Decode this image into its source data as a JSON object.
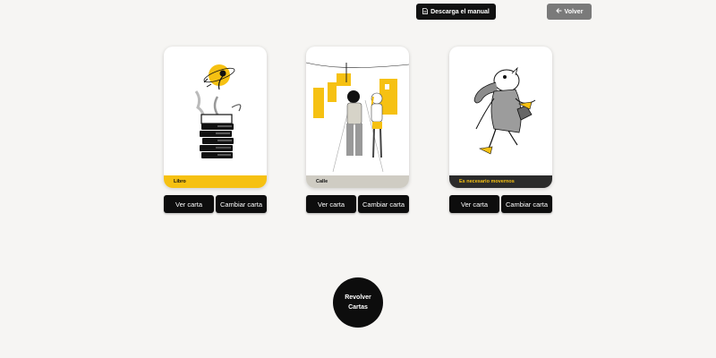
{
  "header": {
    "manual_label": "Descarga el manual",
    "back_label": "Volver"
  },
  "cards": [
    {
      "label": "Libro",
      "view_label": "Ver carta",
      "change_label": "Cambiar carta",
      "label_bg": "#f6c112",
      "label_color": "#111111"
    },
    {
      "label": "Calle",
      "view_label": "Ver carta",
      "change_label": "Cambiar carta",
      "label_bg": "#cfccc3",
      "label_color": "#111111"
    },
    {
      "label": "Es necesario movernos",
      "view_label": "Ver carta",
      "change_label": "Cambiar carta",
      "label_bg": "#2b2b2b",
      "label_color": "#f6c112"
    }
  ],
  "shuffle": {
    "line1": "Revolver",
    "line2": "Cartas"
  },
  "colors": {
    "accent_yellow": "#f6c112",
    "dark": "#0d0d0d",
    "background": "#f6f5f3"
  }
}
